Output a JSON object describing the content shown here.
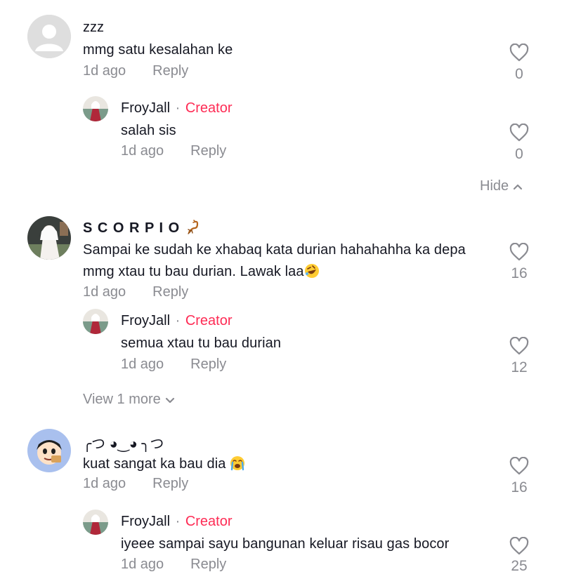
{
  "comments": [
    {
      "user": "zzz",
      "text": "mmg satu kesalahan ke",
      "time": "1d ago",
      "reply_label": "Reply",
      "likes": "0",
      "replies": [
        {
          "user": "FroyJall",
          "sep": "·",
          "badge": "Creator",
          "text": "salah sis",
          "time": "1d ago",
          "reply_label": "Reply",
          "likes": "0"
        }
      ],
      "toggle": "Hide"
    },
    {
      "user": "S C O R P I O",
      "user_emoji": "scorpion",
      "text": "Sampai ke sudah ke xhabaq kata durian hahahahha ka depa",
      "text2": "mmg xtau tu bau durian. Lawak laa",
      "text2_emoji": "rolling-on-floor-laughing",
      "time": "1d ago",
      "reply_label": "Reply",
      "likes": "16",
      "replies": [
        {
          "user": "FroyJall",
          "sep": "·",
          "badge": "Creator",
          "text": "semua xtau tu bau durian",
          "time": "1d ago",
          "reply_label": "Reply",
          "likes": "12"
        }
      ],
      "toggle": "View 1 more"
    },
    {
      "user": "╭つ ◕‿◕ ╮つ",
      "text": "kuat sangat ka bau dia ",
      "text_emoji": "loudly-crying-face",
      "time": "1d ago",
      "reply_label": "Reply",
      "likes": "16",
      "replies": [
        {
          "user": "FroyJall",
          "sep": "·",
          "badge": "Creator",
          "text": "iyeee sampai sayu bangunan keluar risau gas bocor",
          "time": "1d ago",
          "reply_label": "Reply",
          "likes": "25"
        }
      ]
    }
  ],
  "colors": {
    "creator": "#fe2c55",
    "muted": "#8a8b91",
    "text": "#161823"
  }
}
